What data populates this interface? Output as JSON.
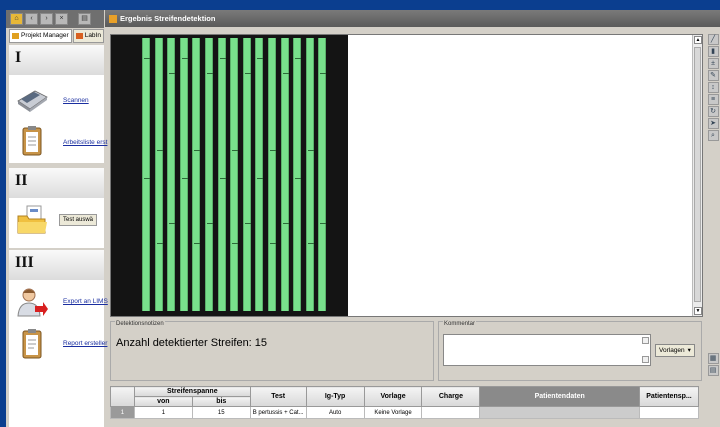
{
  "left_panel": {
    "tabs": [
      "Projekt Manager",
      "LabIn"
    ],
    "sections": [
      {
        "numeral": "I",
        "tools": [
          {
            "label": "Scannen",
            "icon": "scanner-icon"
          },
          {
            "label": "Arbeitsliste erst",
            "icon": "clipboard-icon"
          }
        ]
      },
      {
        "numeral": "II",
        "tools": [
          {
            "label": "Test auswä",
            "icon": "folder-icon"
          }
        ]
      },
      {
        "numeral": "III",
        "tools": [
          {
            "label": "Export an LIMS",
            "icon": "user-export-icon"
          },
          {
            "label": "Report ersteller",
            "icon": "report-clipboard-icon"
          }
        ]
      }
    ]
  },
  "window_title": "Ergebnis Streifendetektion",
  "strip_count_visual": 15,
  "notes": {
    "group_label": "Detektionsnotizen",
    "text": "Anzahl detektierter Streifen: 15"
  },
  "comment": {
    "group_label": "Kommentar",
    "templates_button": "Vorlagen"
  },
  "table": {
    "group_header": "Streifenspanne",
    "von": "von",
    "bis": "bis",
    "columns": [
      "Test",
      "Ig-Typ",
      "Vorlage",
      "Charge",
      "Patientendaten",
      "Patientensp..."
    ],
    "rows": [
      {
        "num": "1",
        "von": "1",
        "bis": "15",
        "test": "B pertussis + Cat...",
        "ig": "Auto",
        "vorlage": "Keine Vorlage",
        "charge": "",
        "patient": "",
        "patsp": ""
      }
    ]
  },
  "colors": {
    "strip": "#78e08c",
    "scan_bg": "#141414",
    "title_bar": "#5a5a5a",
    "link": "#1a2ea0"
  }
}
